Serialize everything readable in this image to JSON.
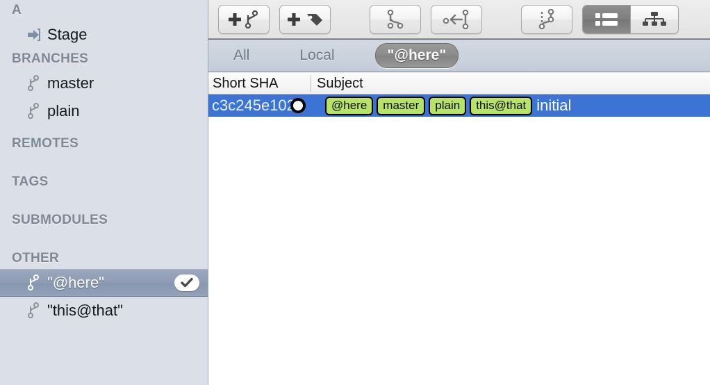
{
  "sidebar": {
    "sections": [
      {
        "name": "A",
        "header": "A",
        "items": [
          {
            "label": "Stage",
            "icon": "stage-arrow-icon",
            "selected": false,
            "checked": false
          }
        ]
      },
      {
        "name": "BRANCHES",
        "header": "BRANCHES",
        "items": [
          {
            "label": "master",
            "icon": "branch-icon",
            "selected": false,
            "checked": false
          },
          {
            "label": "plain",
            "icon": "branch-icon",
            "selected": false,
            "checked": false
          }
        ]
      },
      {
        "name": "REMOTES",
        "header": "REMOTES",
        "items": []
      },
      {
        "name": "TAGS",
        "header": "TAGS",
        "items": []
      },
      {
        "name": "SUBMODULES",
        "header": "SUBMODULES",
        "items": []
      },
      {
        "name": "OTHER",
        "header": "OTHER",
        "items": [
          {
            "label": "\"@here\"",
            "icon": "branch-icon",
            "selected": true,
            "checked": true
          },
          {
            "label": "\"this@that\"",
            "icon": "branch-icon",
            "selected": false,
            "checked": false
          }
        ]
      }
    ],
    "selected_item_label": "\"@here\"",
    "background_color": "#dbdfe8",
    "selection_color": "#8e9cb4"
  },
  "toolbar": {
    "buttons": [
      {
        "name": "new-branch-button",
        "icon": "plus-branch-icon",
        "label": ""
      },
      {
        "name": "new-tag-button",
        "icon": "plus-tag-icon",
        "label": ""
      },
      {
        "name": "branch-button",
        "icon": "branch-split-icon",
        "label": ""
      },
      {
        "name": "merge-button",
        "icon": "merge-arrow-icon",
        "label": ""
      },
      {
        "name": "rebase-button",
        "icon": "rebase-dotted-icon",
        "label": ""
      }
    ],
    "view_toggle": {
      "options": [
        {
          "name": "list-view-button",
          "icon": "list-view-icon",
          "active": true
        },
        {
          "name": "tree-view-button",
          "icon": "tree-view-icon",
          "active": false
        }
      ]
    }
  },
  "tabs": {
    "items": [
      {
        "label": "All",
        "active": false
      },
      {
        "label": "Local",
        "active": false
      },
      {
        "label": "\"@here\"",
        "active": true
      }
    ],
    "active_label": "\"@here\""
  },
  "table": {
    "columns": [
      {
        "label": "Short SHA"
      },
      {
        "label": "Subject"
      }
    ],
    "rows": [
      {
        "short_sha": "c3c245e102",
        "refs": [
          "@here",
          "master",
          "plain",
          "this@that"
        ],
        "subject": "initial",
        "selected": true
      }
    ],
    "selection_color": "#3b74d4",
    "ref_badge_color": "#b7e364"
  }
}
